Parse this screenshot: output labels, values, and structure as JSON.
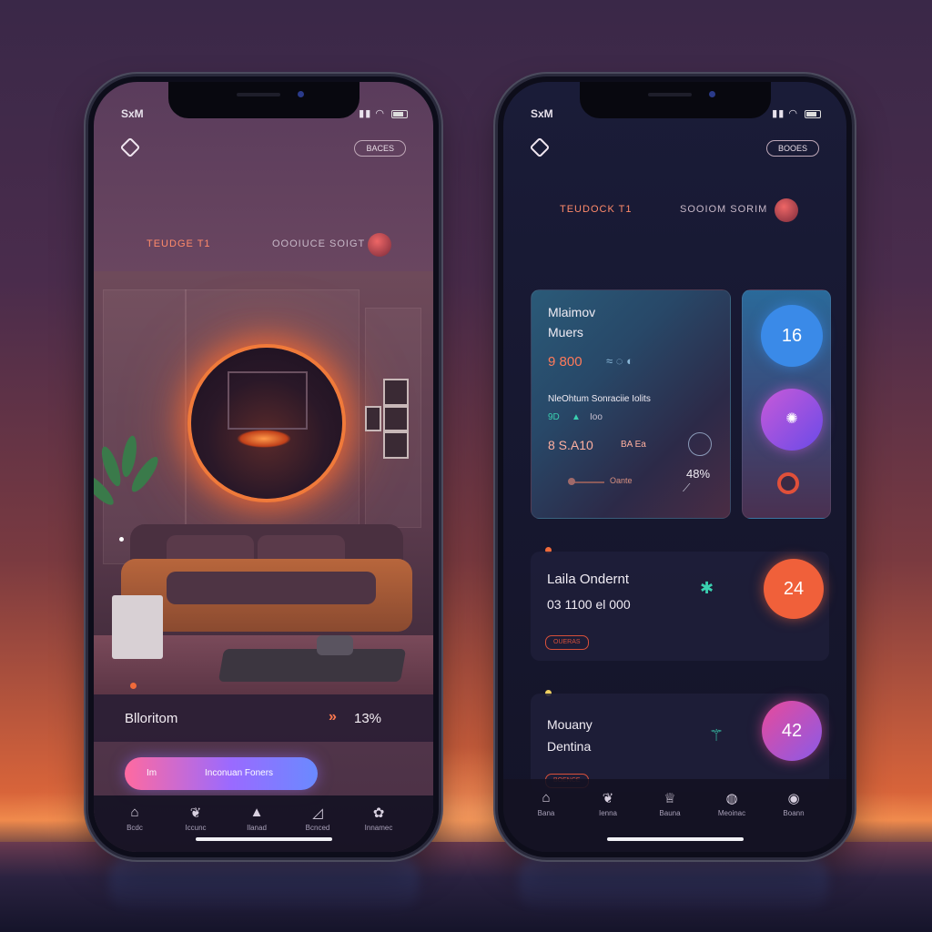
{
  "left_phone": {
    "time": "SxM",
    "status_icons": [
      "signal-icon",
      "wifi-icon",
      "battery-icon"
    ],
    "top_button": "BACES",
    "subtitle_left": "TEUDGE T1",
    "subtitle_right": "OOOIUCE SOIGT",
    "banner": {
      "title": "Blloritom",
      "arrow": "»",
      "value": "13%"
    },
    "cta": {
      "left": "Im",
      "right": "Inconuan Foners"
    },
    "tabs": [
      {
        "icon": "home-icon",
        "label": "Bcdc"
      },
      {
        "icon": "leaf-icon",
        "label": "Iccunc"
      },
      {
        "icon": "chart-icon",
        "label": "Ilanad"
      },
      {
        "icon": "signal-icon",
        "label": "Bcnced"
      },
      {
        "icon": "settings-icon",
        "label": "Innamec"
      }
    ]
  },
  "right_phone": {
    "time": "SxM",
    "top_button": "BOOES",
    "subtitle_left": "TEUDOCK T1",
    "subtitle_right": "SOOIOM SORIM",
    "main_card": {
      "title_line1": "Mlaimov",
      "title_line2": "Muers",
      "amount": "9 800",
      "detail": "NleOhtum Sonraciie Iolits",
      "chips": [
        "9D",
        "Ioo"
      ],
      "amount2": "8 S.A10",
      "amount2_suffix": "BA Ea",
      "footer_label": "Oante",
      "percent": "48%"
    },
    "side_card": {
      "value_top": "16"
    },
    "row1": {
      "title": "Laila Ondernt",
      "subtitle": "03 1100 el 000",
      "tag": "OUERAS",
      "value": "24"
    },
    "row2": {
      "title_line1": "Mouany",
      "title_line2": "Dentina",
      "tag": "BOENCE",
      "value": "42"
    },
    "tabs": [
      {
        "icon": "home-icon",
        "label": "Bana"
      },
      {
        "icon": "leaf-icon",
        "label": "Ienna"
      },
      {
        "icon": "chart-icon",
        "label": "Bauna"
      },
      {
        "icon": "globe-icon",
        "label": "Meoinac"
      },
      {
        "icon": "user-icon",
        "label": "Boann"
      }
    ]
  },
  "colors": {
    "accent_orange": "#f06a3a",
    "accent_blue": "#3a8ae8",
    "accent_pink": "#e85aa0",
    "accent_purple": "#9a5ad8"
  }
}
